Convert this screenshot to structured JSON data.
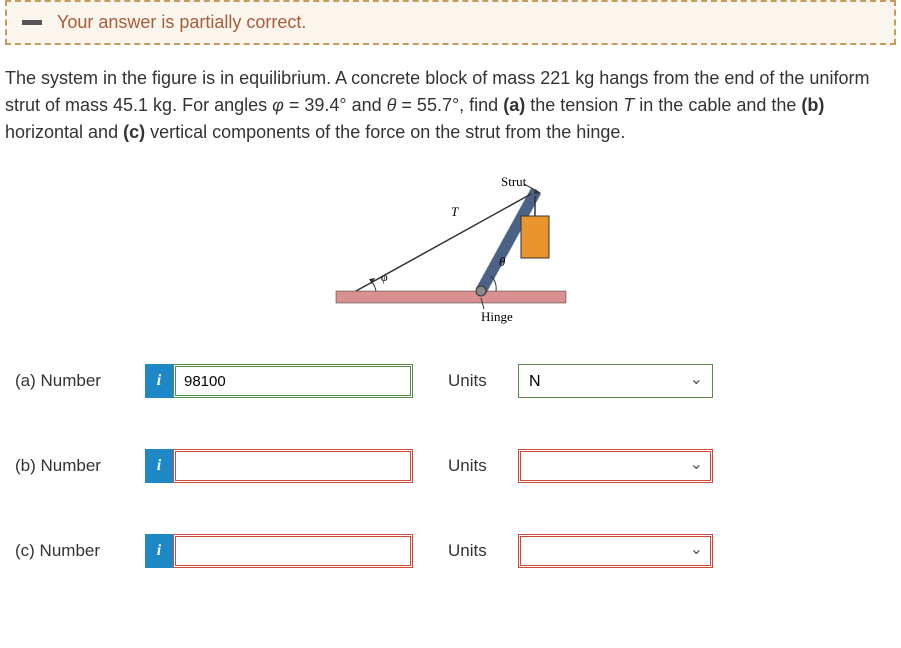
{
  "feedback": {
    "text": "Your answer is partially correct."
  },
  "question": {
    "intro": "The system in the figure is in equilibrium. A concrete block of mass 221 kg hangs from the end of the uniform strut of mass 45.1 kg. For angles ",
    "phi": "φ",
    "phi_val": " = 39.4° and ",
    "theta": "θ",
    "theta_val": " = 55.7°, find ",
    "a_lbl": "(a)",
    "a_txt": " the tension ",
    "t_var": "T",
    "a_txt2": " in the cable and the ",
    "b_lbl": "(b)",
    "b_txt": " horizontal and ",
    "c_lbl": "(c)",
    "c_txt": " vertical components of the force on the strut from the hinge."
  },
  "figure": {
    "strut_label": "Strut",
    "t_label": "T",
    "phi_label": "φ",
    "theta_label": "θ",
    "hinge_label": "Hinge"
  },
  "rows": {
    "a": {
      "label": "(a)   Number",
      "value": "98100",
      "units_label": "Units",
      "units_value": "N"
    },
    "b": {
      "label": "(b)   Number",
      "value": "",
      "units_label": "Units",
      "units_value": ""
    },
    "c": {
      "label": "(c)   Number",
      "value": "",
      "units_label": "Units",
      "units_value": ""
    }
  },
  "info_icon": "i"
}
